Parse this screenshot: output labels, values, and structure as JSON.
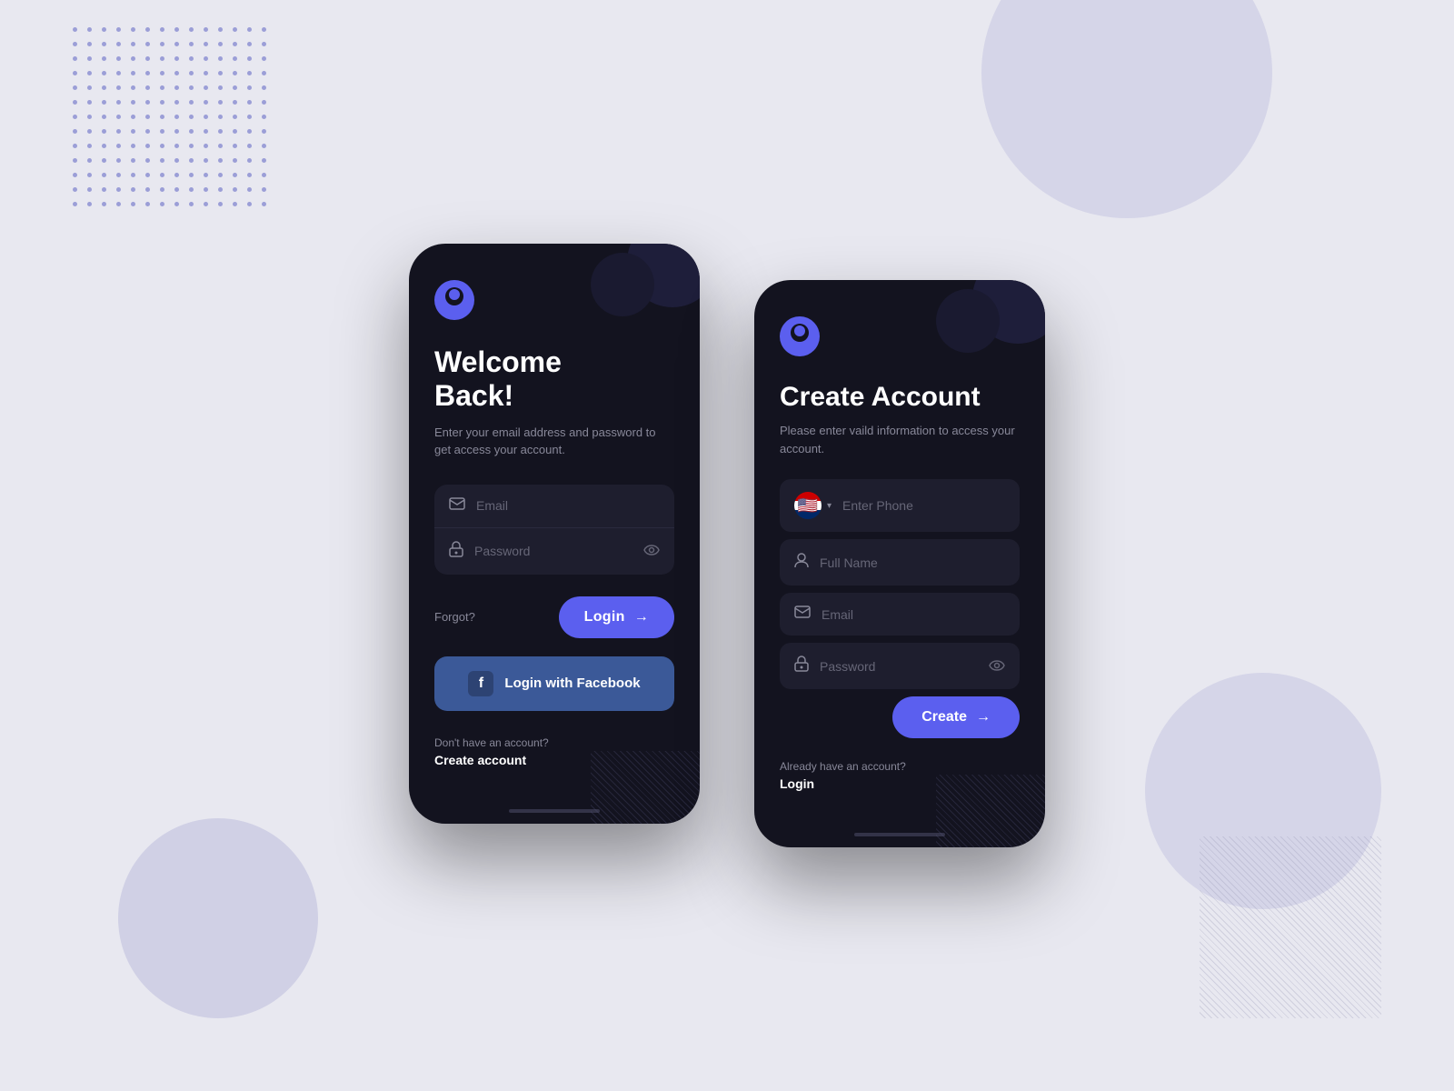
{
  "background": {
    "color": "#e8e8f0"
  },
  "phone1": {
    "title": "Welcome\nBack!",
    "subtitle": "Enter your email address and password to get access your account.",
    "email_placeholder": "Email",
    "password_placeholder": "Password",
    "forgot_label": "Forgot?",
    "login_button": "Login",
    "facebook_button": "Login with Facebook",
    "no_account_prompt": "Don't have an account?",
    "create_account_link": "Create account"
  },
  "phone2": {
    "title": "Create Account",
    "subtitle": "Please enter vaild information to access your account.",
    "phone_placeholder": "Enter Phone",
    "fullname_placeholder": "Full Name",
    "email_placeholder": "Email",
    "password_placeholder": "Password",
    "create_button": "Create",
    "already_prompt": "Already  have an account?",
    "login_link": "Login",
    "flag_country": "US"
  }
}
